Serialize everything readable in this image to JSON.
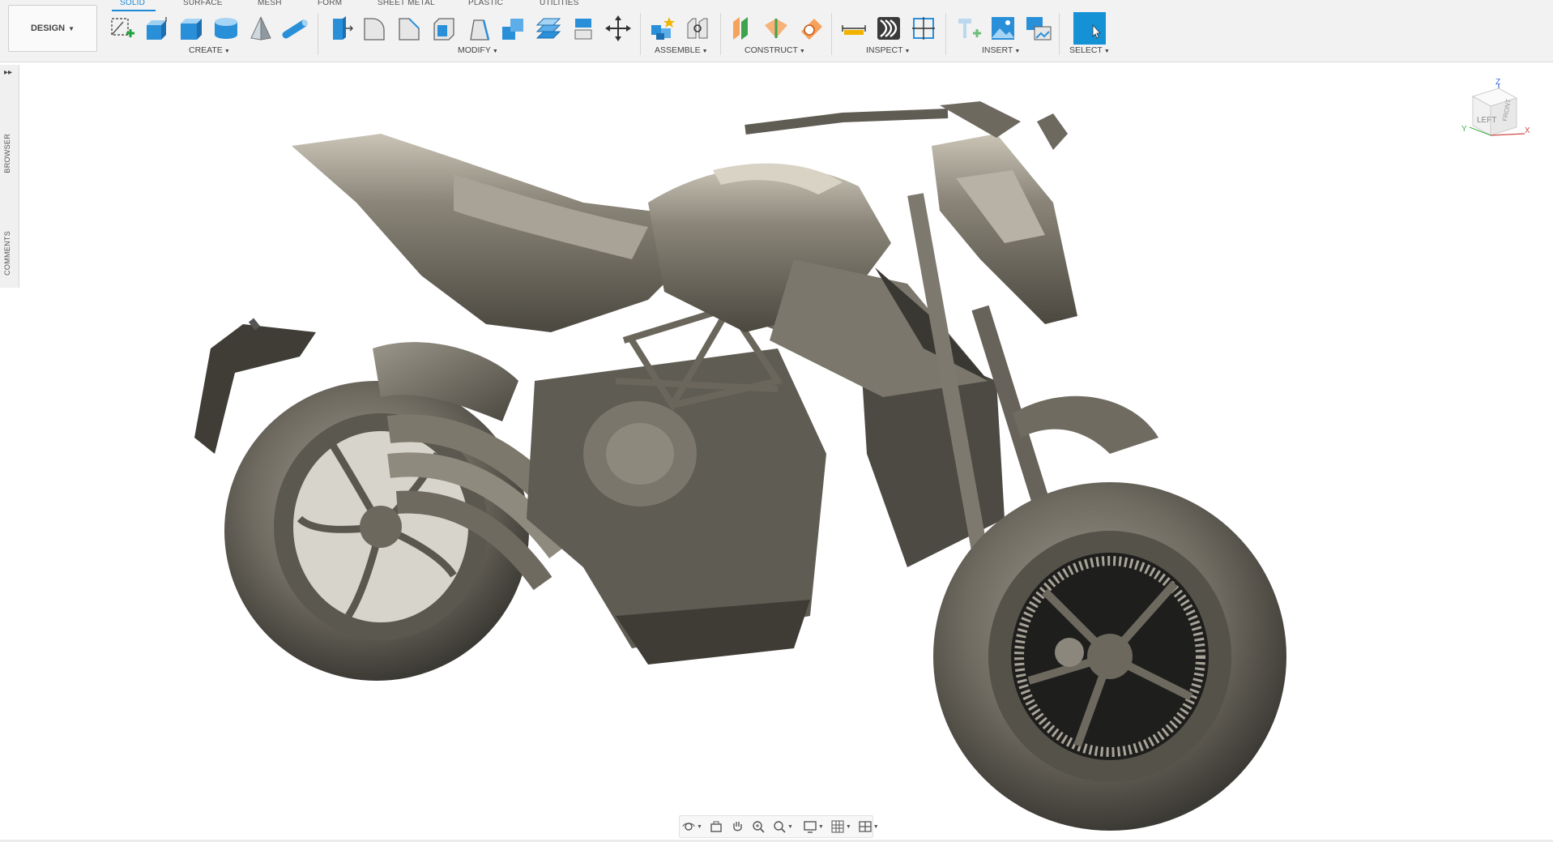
{
  "workspace": {
    "label": "DESIGN"
  },
  "tabs": [
    {
      "label": "SOLID",
      "active": true
    },
    {
      "label": "SURFACE"
    },
    {
      "label": "MESH"
    },
    {
      "label": "FORM"
    },
    {
      "label": "SHEET METAL"
    },
    {
      "label": "PLASTIC"
    },
    {
      "label": "UTILITIES"
    }
  ],
  "groups": {
    "create": "CREATE",
    "modify": "MODIFY",
    "assemble": "ASSEMBLE",
    "construct": "CONSTRUCT",
    "inspect": "INSPECT",
    "insert": "INSERT",
    "select": "SELECT"
  },
  "tools": {
    "create": [
      "create-sketch-icon",
      "extrude-icon",
      "box-icon",
      "cylinder-icon",
      "pyramid-icon",
      "pipe-icon"
    ],
    "modify": [
      "press-pull-icon",
      "fillet-icon",
      "chamfer-icon",
      "shell-icon",
      "draft-icon",
      "combine-icon",
      "offset-face-icon",
      "split-body-icon",
      "move-icon"
    ],
    "assemble": [
      "new-component-icon",
      "joint-icon"
    ],
    "construct": [
      "offset-plane-icon",
      "plane-at-angle-icon",
      "tangent-plane-icon"
    ],
    "inspect": [
      "measure-icon",
      "zebra-analysis-icon",
      "section-analysis-icon"
    ],
    "insert": [
      "insert-mesh-icon",
      "decal-icon",
      "canvas-icon"
    ],
    "select": [
      "select-icon"
    ]
  },
  "left_panel": {
    "browser": "BROWSER",
    "comments": "COMMENTS"
  },
  "viewcube": {
    "face": "LEFT",
    "side": "FRONT",
    "axis_z": "Z",
    "axis_x": "X",
    "axis_y": "Y"
  },
  "colors": {
    "accent": "#1a8bd6",
    "toolbar_bg": "#f2f2f2",
    "model": "#6f6b61",
    "select_button": "#1592d6"
  },
  "navbar": [
    "orbit-icon",
    "look-at-icon",
    "pan-icon",
    "zoom-icon",
    "zoom-window-icon",
    "display-settings-icon",
    "grid-icon",
    "viewports-icon"
  ]
}
